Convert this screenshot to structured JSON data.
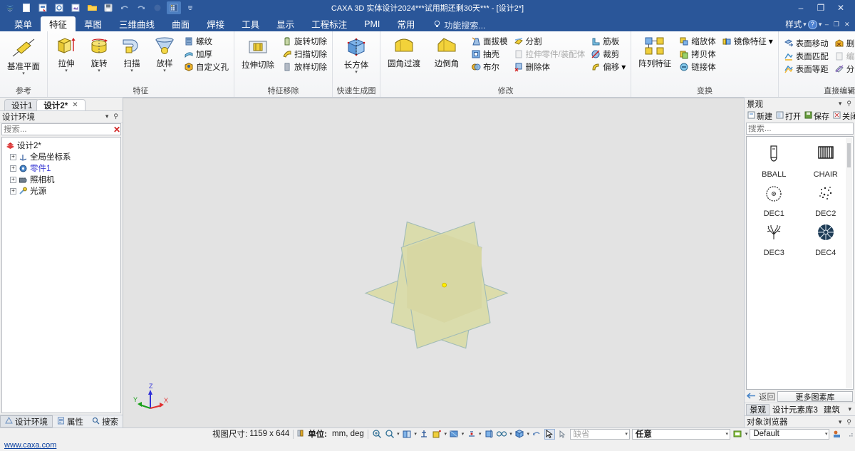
{
  "titlebar": {
    "title": "CAXA 3D 实体设计2024***试用期还剩30天*** - [设计2*]",
    "quick_access": [
      {
        "name": "app-logo-icon",
        "label": "CAXA"
      },
      {
        "name": "new-document-icon",
        "label": "新建"
      },
      {
        "name": "open-template-red-icon",
        "label": "模板"
      },
      {
        "name": "open-blue-icon",
        "label": "打开设计"
      },
      {
        "name": "open-purple-icon",
        "label": "打开图纸"
      },
      {
        "name": "open-folder-icon",
        "label": "打开"
      },
      {
        "name": "save-icon",
        "label": "保存"
      },
      {
        "name": "undo-icon",
        "label": "撤销"
      },
      {
        "name": "redo-icon",
        "label": "重做"
      },
      {
        "name": "print-icon",
        "label": "打印"
      },
      {
        "name": "options-grid-icon",
        "label": "选项"
      },
      {
        "name": "customize-qat-icon",
        "label": "自定义"
      }
    ],
    "minimize": "–",
    "maximize": "❐",
    "close": "✕"
  },
  "tabs": {
    "items": [
      {
        "label": "菜单",
        "active": false
      },
      {
        "label": "特征",
        "active": true
      },
      {
        "label": "草图",
        "active": false
      },
      {
        "label": "三维曲线",
        "active": false
      },
      {
        "label": "曲面",
        "active": false
      },
      {
        "label": "焊接",
        "active": false
      },
      {
        "label": "工具",
        "active": false
      },
      {
        "label": "显示",
        "active": false
      },
      {
        "label": "工程标注",
        "active": false
      },
      {
        "label": "PMI",
        "active": false
      },
      {
        "label": "常用",
        "active": false
      }
    ],
    "function_search": "功能搜索...",
    "style_label": "样式",
    "help_label": "?"
  },
  "ribbon": {
    "groups": [
      {
        "title": "参考",
        "big": [
          {
            "label": "基准平面",
            "icon": "datum-plane-icon",
            "caret": true
          }
        ],
        "small": []
      },
      {
        "title": "特征",
        "big": [
          {
            "label": "拉伸",
            "icon": "extrude-icon",
            "caret": true
          },
          {
            "label": "旋转",
            "icon": "revolve-icon",
            "caret": true
          },
          {
            "label": "扫描",
            "icon": "sweep-icon",
            "caret": true
          },
          {
            "label": "放样",
            "icon": "loft-icon",
            "caret": true
          }
        ],
        "small": [
          {
            "label": "螺纹",
            "icon": "thread-icon",
            "disabled": false
          },
          {
            "label": "加厚",
            "icon": "thicken-icon",
            "disabled": false
          },
          {
            "label": "自定义孔",
            "icon": "custom-hole-icon",
            "disabled": false
          }
        ]
      },
      {
        "title": "特征移除",
        "big": [
          {
            "label": "拉伸切除",
            "icon": "extrude-cut-icon",
            "caret": false
          }
        ],
        "small": [
          {
            "label": "旋转切除",
            "icon": "revolve-cut-icon",
            "disabled": false
          },
          {
            "label": "扫描切除",
            "icon": "sweep-cut-icon",
            "disabled": false
          },
          {
            "label": "放样切除",
            "icon": "loft-cut-icon",
            "disabled": false
          }
        ]
      },
      {
        "title": "快速生成图素",
        "big": [
          {
            "label": "长方体",
            "icon": "box-primitive-icon",
            "caret": true
          }
        ],
        "small": []
      },
      {
        "title": "修改",
        "big": [
          {
            "label": "圆角过渡",
            "icon": "fillet-icon",
            "caret": false
          },
          {
            "label": "边倒角",
            "icon": "chamfer-icon",
            "caret": false
          }
        ],
        "small_col_1": [
          {
            "label": "面拔模",
            "icon": "draft-face-icon",
            "disabled": false
          },
          {
            "label": "抽壳",
            "icon": "shell-icon",
            "disabled": false
          },
          {
            "label": "布尔",
            "icon": "boolean-icon",
            "disabled": false
          }
        ],
        "small_col_2": [
          {
            "label": "分割",
            "icon": "split-icon",
            "disabled": false
          },
          {
            "label": "拉伸零件/装配体",
            "icon": "stretch-part-icon",
            "disabled": true
          },
          {
            "label": "删除体",
            "icon": "delete-body-icon",
            "disabled": false
          }
        ],
        "small_col_3": [
          {
            "label": "筋板",
            "icon": "rib-icon",
            "disabled": false
          },
          {
            "label": "裁剪",
            "icon": "trim-icon",
            "disabled": false
          },
          {
            "label": "偏移",
            "icon": "offset-icon",
            "disabled": false,
            "caret": true
          }
        ]
      },
      {
        "title": "变换",
        "big": [
          {
            "label": "阵列特征",
            "icon": "pattern-feature-icon",
            "caret": false
          }
        ],
        "small": [
          {
            "label": "缩放体",
            "icon": "scale-body-icon",
            "disabled": false
          },
          {
            "label": "拷贝体",
            "icon": "copy-body-icon",
            "disabled": false
          },
          {
            "label": "链接体",
            "icon": "link-body-icon",
            "disabled": false
          }
        ],
        "small_col_2": [
          {
            "label": "镜像特征",
            "icon": "mirror-feature-icon",
            "disabled": false,
            "caret": true
          }
        ]
      },
      {
        "title": "直接编辑",
        "small_col_1": [
          {
            "label": "表面移动",
            "icon": "move-face-icon",
            "disabled": false
          },
          {
            "label": "表面匹配",
            "icon": "match-face-icon",
            "disabled": false
          },
          {
            "label": "表面等距",
            "icon": "offset-face-icon",
            "disabled": false
          }
        ],
        "small_col_2": [
          {
            "label": "删除表面",
            "icon": "delete-face-icon",
            "disabled": false
          },
          {
            "label": "编辑表面半径",
            "icon": "edit-face-radius-icon",
            "disabled": true
          },
          {
            "label": "分割实体表面",
            "icon": "split-solid-face-icon",
            "disabled": false
          }
        ]
      }
    ]
  },
  "left_panel": {
    "doc_tabs": [
      {
        "label": "设计1",
        "active": false,
        "closable": false
      },
      {
        "label": "设计2*",
        "active": true,
        "closable": true,
        "close": "✕"
      }
    ],
    "header": "设计环境",
    "header_icons": [
      {
        "name": "panel-dropdown-icon",
        "glyph": "▾"
      },
      {
        "name": "pin-icon",
        "glyph": "⚲"
      }
    ],
    "search_placeholder": "搜索...",
    "search_clear": "✕",
    "search_filter_icon": "filter-az-icon",
    "tree": [
      {
        "label": "设计2*",
        "level": 1,
        "icon": "design-root-icon",
        "expander": "",
        "color": "#1a1a1a"
      },
      {
        "label": "全局坐标系",
        "level": 2,
        "icon": "global-coordinate-icon",
        "expander": "+",
        "color": "#1a1a1a"
      },
      {
        "label": "零件1",
        "level": 2,
        "icon": "part-icon",
        "expander": "+",
        "color": "#3b3bd4"
      },
      {
        "label": "照相机",
        "level": 2,
        "icon": "camera-icon",
        "expander": "+",
        "color": "#1a1a1a"
      },
      {
        "label": "光源",
        "level": 2,
        "icon": "light-source-icon",
        "expander": "+",
        "color": "#1a1a1a"
      }
    ],
    "bottom_tabs": [
      {
        "label": "设计环境",
        "icon": "design-env-icon",
        "active": true
      },
      {
        "label": "属性",
        "icon": "properties-icon",
        "active": false
      },
      {
        "label": "搜索",
        "icon": "search-icon",
        "active": false
      }
    ]
  },
  "viewport": {
    "axis": {
      "x": "X",
      "y": "Y",
      "z": "Z",
      "x_color": "#e03030",
      "y_color": "#18a018",
      "z_color": "#3030d8"
    },
    "plane_color": "#d9d98a",
    "plane_edge_color": "#7aa8a0",
    "origin_color": "#ffee00",
    "background": "#e3e3e3"
  },
  "right_panel": {
    "header": "景观",
    "header_icons": [
      {
        "name": "panel-dropdown-icon",
        "glyph": "▾"
      },
      {
        "name": "pin-icon",
        "glyph": "⚲"
      }
    ],
    "toolbar": [
      {
        "label": "新建",
        "icon": "new-library-icon"
      },
      {
        "label": "打开",
        "icon": "open-library-icon"
      },
      {
        "label": "保存",
        "icon": "save-library-icon"
      },
      {
        "label": "关闭",
        "icon": "close-library-icon"
      }
    ],
    "search_placeholder": "搜索...",
    "search_clear": "✕",
    "items": [
      {
        "name": "BBALL",
        "icon": "bball-icon"
      },
      {
        "name": "CHAIR",
        "icon": "chair-icon"
      },
      {
        "name": "DEC1",
        "icon": "dec1-icon"
      },
      {
        "name": "DEC2",
        "icon": "dec2-icon"
      },
      {
        "name": "DEC3",
        "icon": "dec3-icon"
      },
      {
        "name": "DEC4",
        "icon": "dec4-icon"
      }
    ],
    "back_label": "返回",
    "more_libraries_label": "更多图素库",
    "lib_tabs": [
      {
        "label": "景观",
        "active": true
      },
      {
        "label": "设计元素库3",
        "active": false
      },
      {
        "label": "建筑",
        "active": false
      }
    ],
    "lib_tabs_caret": "▾",
    "object_browser": "对象浏览器",
    "object_browser_icons": [
      {
        "name": "panel-dropdown-icon",
        "glyph": "▾"
      },
      {
        "name": "pin-icon",
        "glyph": "⚲"
      }
    ]
  },
  "statusbar": {
    "view_size_label": "视图尺寸:",
    "view_size_value": "1159 x  644",
    "unit_label": "单位:",
    "unit_value": "mm, deg",
    "tools": [
      {
        "name": "zoom-in-icon",
        "caret": false
      },
      {
        "name": "zoom-window-icon",
        "caret": true
      },
      {
        "name": "view-orientation-icon",
        "caret": true
      },
      {
        "name": "anchor-icon",
        "caret": false
      },
      {
        "name": "render-shaded-icon",
        "caret": true
      },
      {
        "name": "display-mode-icon",
        "caret": true
      },
      {
        "name": "grid-snap-icon",
        "caret": true
      },
      {
        "name": "shading-box-icon",
        "caret": false
      },
      {
        "name": "glasses-icon",
        "caret": true
      },
      {
        "name": "part-color-icon",
        "caret": true
      },
      {
        "name": "undo-view-icon",
        "caret": false
      },
      {
        "name": "select-arrow-icon",
        "caret": false,
        "pressed": true
      },
      {
        "name": "select-face-icon",
        "caret": false
      }
    ],
    "default_combo_placeholder": "缺省",
    "selection_combo_value": "任意",
    "render_style_icon": "render-style-icon",
    "style_combo_value": "Default",
    "end_icon": "scene-props-icon"
  },
  "footer": {
    "link": "www.caxa.com"
  }
}
